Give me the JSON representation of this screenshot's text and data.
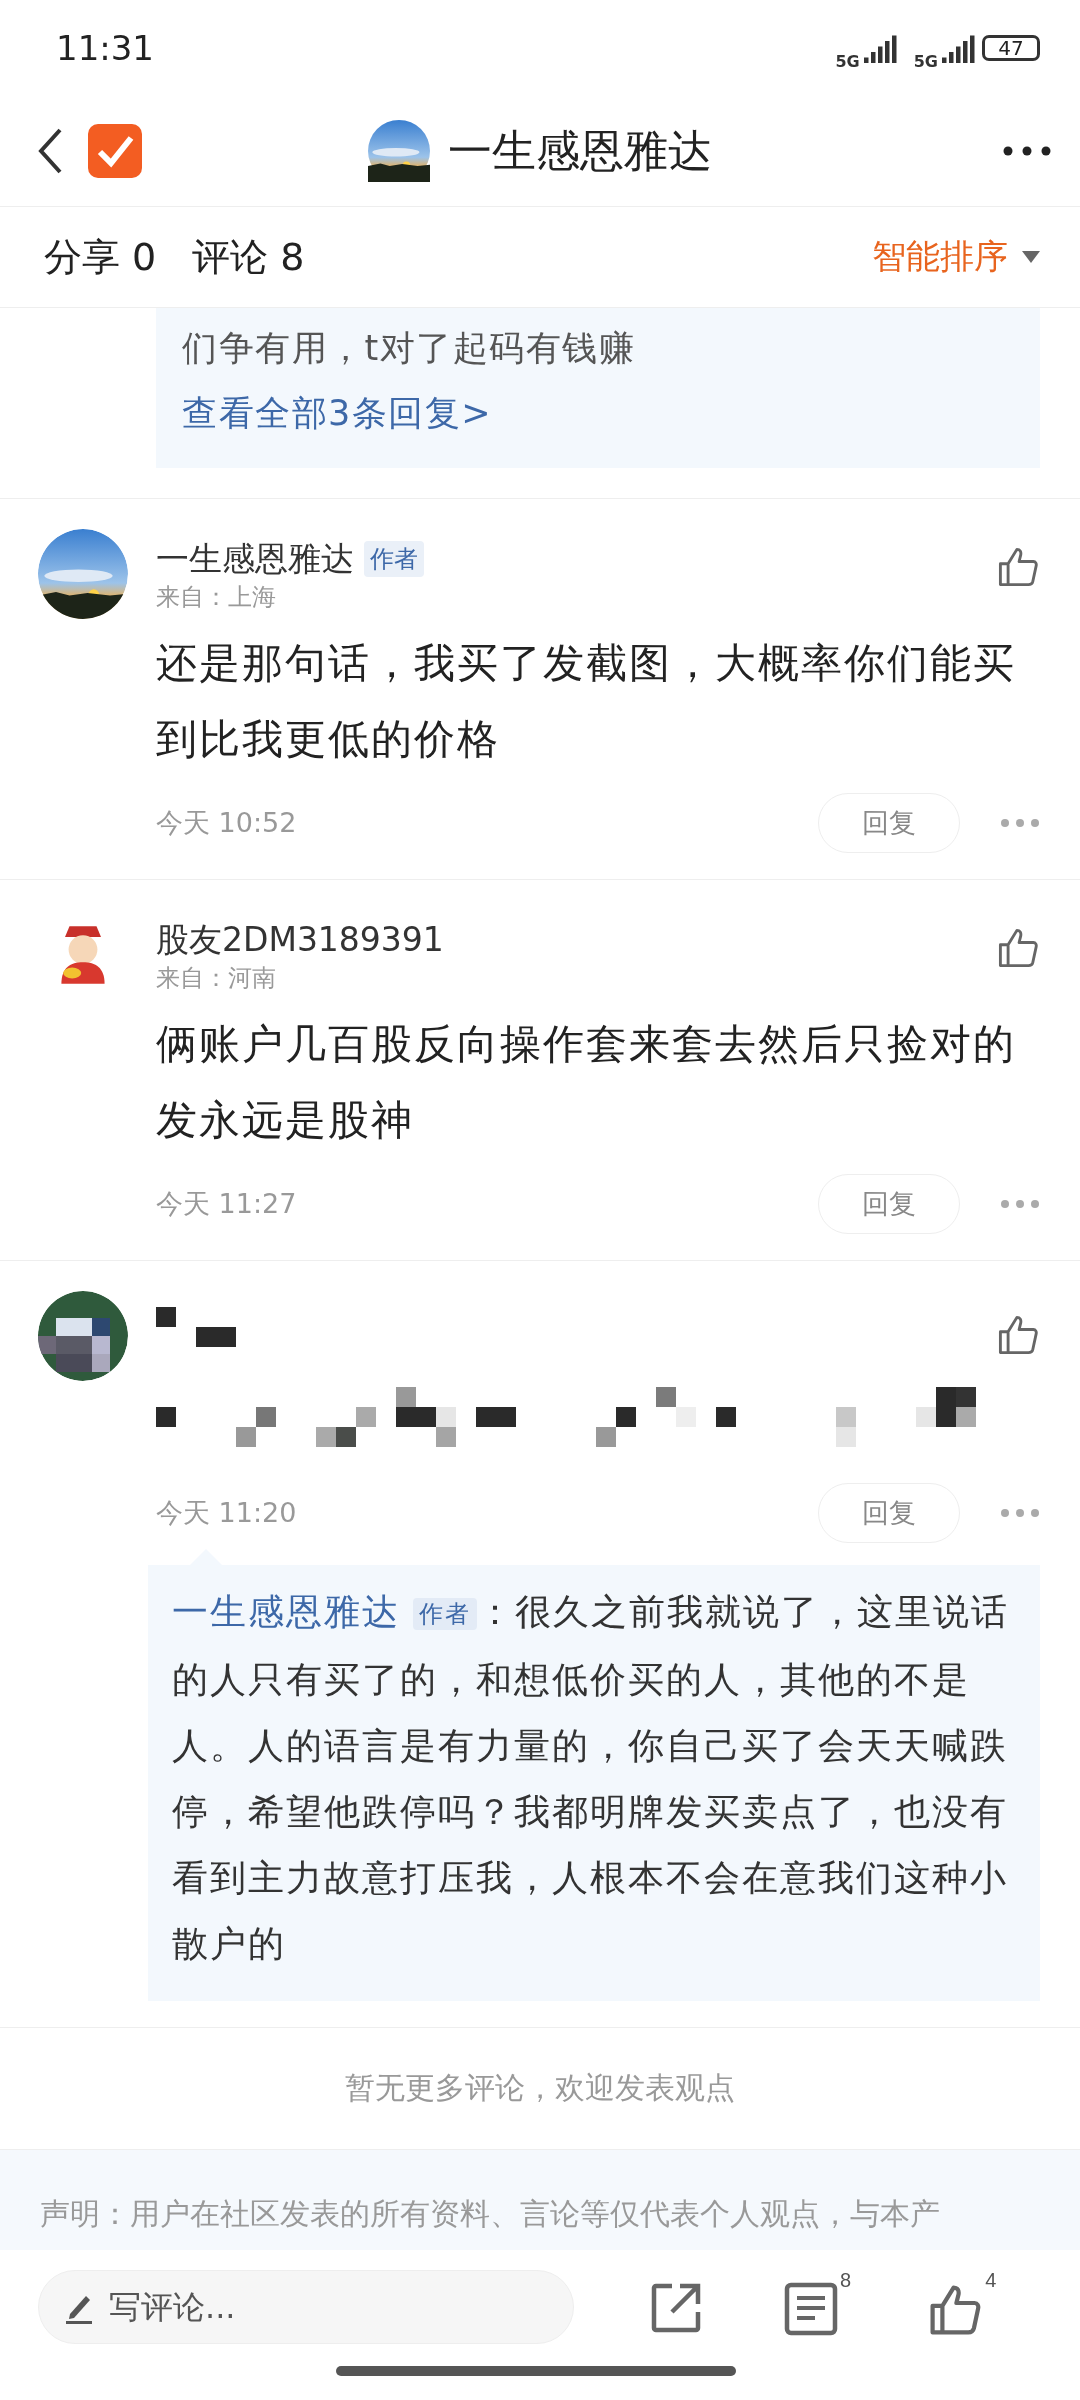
{
  "status_bar": {
    "time": "11:31",
    "networks": [
      "5G",
      "5G"
    ],
    "battery": "47"
  },
  "header": {
    "title": "一生感恩雅达"
  },
  "stats": {
    "share": "分享 0",
    "comments": "评论 8",
    "sort": "智能排序"
  },
  "top_reply": {
    "text": "们争有用，t对了起码有钱赚",
    "link": "查看全部3条回复>"
  },
  "comments": [
    {
      "kind": "text",
      "name": "一生感恩雅达",
      "badge": "作者",
      "location": "来自：上海",
      "body": "还是那句话，我买了发截图，大概率你们能买到比我更低的价格",
      "time": "今天 10:52",
      "reply_button": "回复"
    },
    {
      "kind": "text",
      "name": "股友2DM3189391",
      "location": "来自：河南",
      "body": "俩账户几百股反向操作套来套去然后只捡对的发永远是股神",
      "time": "今天 11:27",
      "reply_button": "回复"
    },
    {
      "kind": "censored",
      "time": "今天 11:20",
      "reply_button": "回复",
      "reply": {
        "name": "一生感恩雅达",
        "badge": "作者",
        "text": "：很久之前我就说了，这里说话的人只有买了的，和想低价买的人，其他的不是人。人的语言是有力量的，你自己买了会天天喊跌停，希望他跌停吗？我都明牌发买卖点了，也没有看到主力故意打压我，人根本不会在意我们这种小散户的"
      }
    }
  ],
  "end_note": "暂无更多评论，欢迎发表观点",
  "disclaimer": "声明：用户在社区发表的所有资料、言论等仅代表个人观点，与本产",
  "bottom_bar": {
    "placeholder": "写评论...",
    "comment_count": "8",
    "like_count": "4"
  }
}
